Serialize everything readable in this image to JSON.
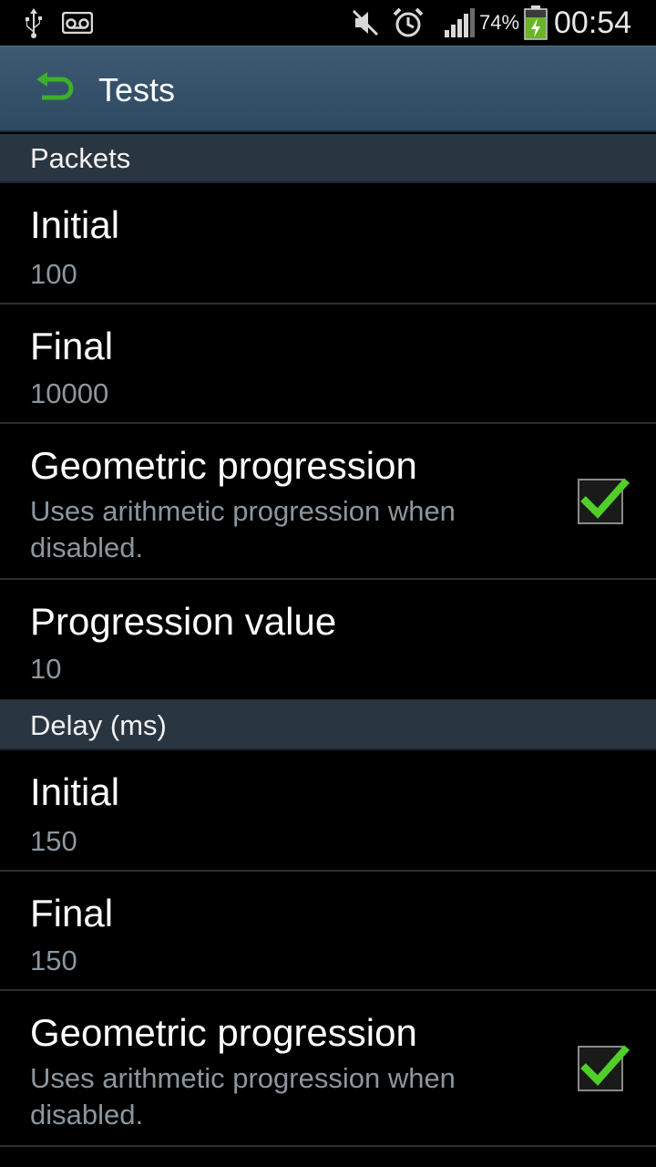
{
  "status_bar": {
    "battery_percent": "74%",
    "time": "00:54",
    "icons": [
      "usb-icon",
      "voicemail-icon",
      "mute-icon",
      "alarm-icon",
      "signal-icon",
      "battery-charging-icon"
    ]
  },
  "action_bar": {
    "title": "Tests",
    "back_icon": "back-arrow-icon",
    "accent_color": "#3cb02a"
  },
  "sections": [
    {
      "header": "Packets",
      "items": [
        {
          "title": "Initial",
          "summary": "100"
        },
        {
          "title": "Final",
          "summary": "10000"
        },
        {
          "title": "Geometric progression",
          "summary": "Uses arithmetic progression when disabled.",
          "checked": true
        },
        {
          "title": "Progression value",
          "summary": "10"
        }
      ]
    },
    {
      "header": "Delay (ms)",
      "items": [
        {
          "title": "Initial",
          "summary": "150"
        },
        {
          "title": "Final",
          "summary": "150"
        },
        {
          "title": "Geometric progression",
          "summary": "Uses arithmetic progression when disabled.",
          "checked": true
        }
      ]
    }
  ]
}
